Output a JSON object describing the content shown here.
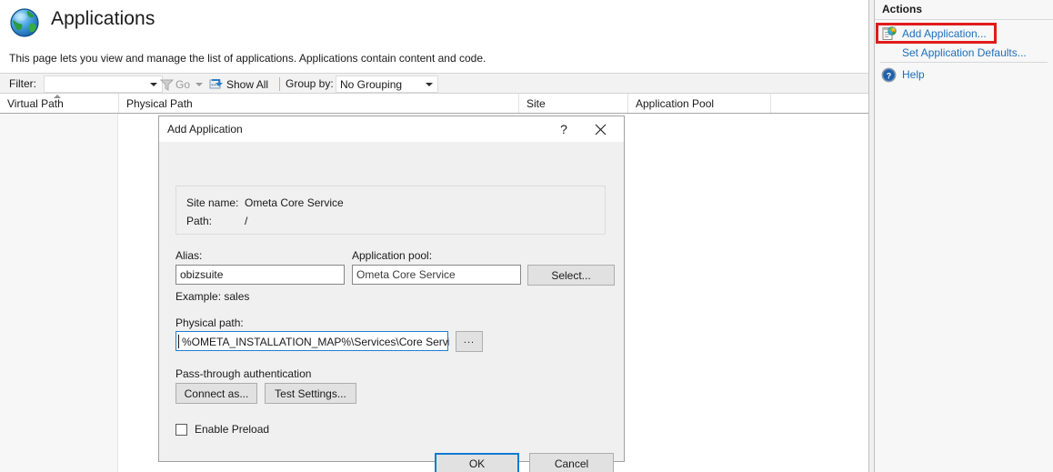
{
  "page": {
    "title": "Applications",
    "description": "This page lets you view and manage the list of applications. Applications contain content and code.",
    "icon": "globe-icon"
  },
  "toolbar": {
    "filter_label": "Filter:",
    "filter_value": "",
    "go_label": "Go",
    "go_icon": "funnel-icon",
    "show_all_label": "Show All",
    "show_all_icon": "show-all-icon",
    "group_by_label": "Group by:",
    "group_by_value": "No Grouping"
  },
  "list": {
    "columns": [
      {
        "label": "Virtual Path",
        "sorted": "asc"
      },
      {
        "label": "Physical Path",
        "sorted": "none"
      },
      {
        "label": "Site",
        "sorted": "none"
      },
      {
        "label": "Application Pool",
        "sorted": "none"
      },
      {
        "label": "",
        "sorted": "none"
      }
    ],
    "rows": []
  },
  "actions": {
    "title": "Actions",
    "items": [
      {
        "label": "Add Application...",
        "icon": "add-application-icon",
        "highlighted": true
      },
      {
        "label": "Set Application Defaults...",
        "icon": "none",
        "highlighted": false
      },
      {
        "label": "Help",
        "icon": "help-icon",
        "highlighted": false
      }
    ],
    "highlight_color": "#e21b1b",
    "link_color": "#1d6fbd"
  },
  "dialog": {
    "title": "Add Application",
    "help_glyph": "?",
    "close_glyph": "close-icon",
    "site_name_label": "Site name:",
    "site_name_value": "Ometa Core Service",
    "path_label": "Path:",
    "path_value": "/",
    "alias_label": "Alias:",
    "alias_value": "obizsuite",
    "alias_example": "Example: sales",
    "app_pool_label": "Application pool:",
    "app_pool_value": "Ometa Core Service",
    "select_label": "Select...",
    "physical_path_label": "Physical path:",
    "physical_path_value": "%OMETA_INSTALLATION_MAP%\\Services\\Core Service\\",
    "browse_label": "...",
    "passthrough_label": "Pass-through authentication",
    "connect_as_label": "Connect as...",
    "test_settings_label": "Test Settings...",
    "enable_preload_label": "Enable Preload",
    "enable_preload_checked": false,
    "ok_label": "OK",
    "cancel_label": "Cancel",
    "focus_color": "#0a7cd1"
  }
}
